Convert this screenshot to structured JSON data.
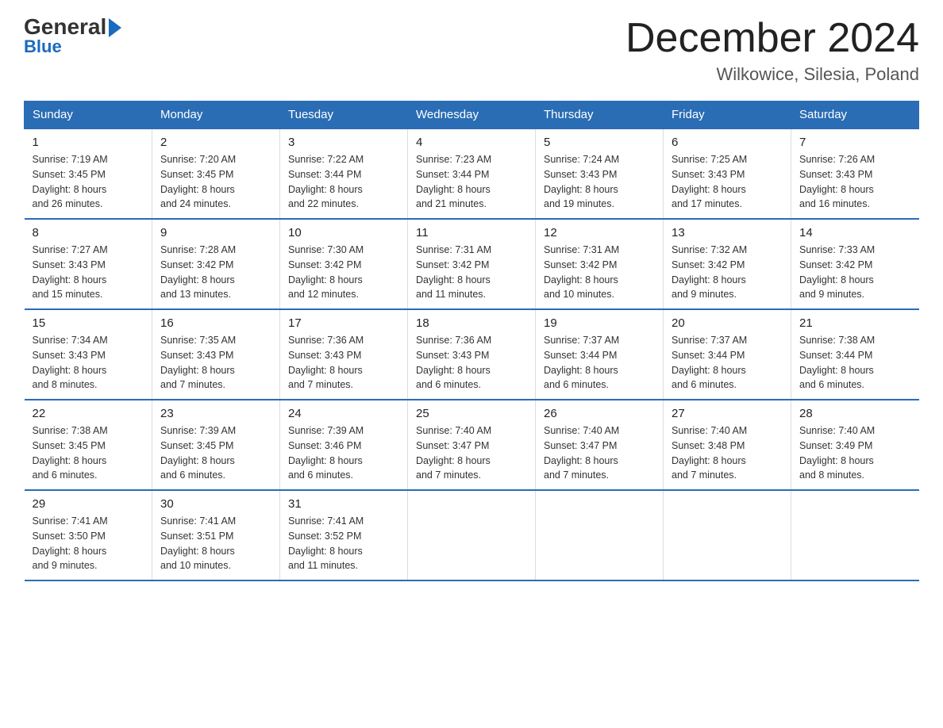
{
  "header": {
    "logo_general": "General",
    "logo_blue": "Blue",
    "month_year": "December 2024",
    "location": "Wilkowice, Silesia, Poland"
  },
  "calendar": {
    "days_of_week": [
      "Sunday",
      "Monday",
      "Tuesday",
      "Wednesday",
      "Thursday",
      "Friday",
      "Saturday"
    ],
    "weeks": [
      [
        {
          "day": "1",
          "info": "Sunrise: 7:19 AM\nSunset: 3:45 PM\nDaylight: 8 hours\nand 26 minutes."
        },
        {
          "day": "2",
          "info": "Sunrise: 7:20 AM\nSunset: 3:45 PM\nDaylight: 8 hours\nand 24 minutes."
        },
        {
          "day": "3",
          "info": "Sunrise: 7:22 AM\nSunset: 3:44 PM\nDaylight: 8 hours\nand 22 minutes."
        },
        {
          "day": "4",
          "info": "Sunrise: 7:23 AM\nSunset: 3:44 PM\nDaylight: 8 hours\nand 21 minutes."
        },
        {
          "day": "5",
          "info": "Sunrise: 7:24 AM\nSunset: 3:43 PM\nDaylight: 8 hours\nand 19 minutes."
        },
        {
          "day": "6",
          "info": "Sunrise: 7:25 AM\nSunset: 3:43 PM\nDaylight: 8 hours\nand 17 minutes."
        },
        {
          "day": "7",
          "info": "Sunrise: 7:26 AM\nSunset: 3:43 PM\nDaylight: 8 hours\nand 16 minutes."
        }
      ],
      [
        {
          "day": "8",
          "info": "Sunrise: 7:27 AM\nSunset: 3:43 PM\nDaylight: 8 hours\nand 15 minutes."
        },
        {
          "day": "9",
          "info": "Sunrise: 7:28 AM\nSunset: 3:42 PM\nDaylight: 8 hours\nand 13 minutes."
        },
        {
          "day": "10",
          "info": "Sunrise: 7:30 AM\nSunset: 3:42 PM\nDaylight: 8 hours\nand 12 minutes."
        },
        {
          "day": "11",
          "info": "Sunrise: 7:31 AM\nSunset: 3:42 PM\nDaylight: 8 hours\nand 11 minutes."
        },
        {
          "day": "12",
          "info": "Sunrise: 7:31 AM\nSunset: 3:42 PM\nDaylight: 8 hours\nand 10 minutes."
        },
        {
          "day": "13",
          "info": "Sunrise: 7:32 AM\nSunset: 3:42 PM\nDaylight: 8 hours\nand 9 minutes."
        },
        {
          "day": "14",
          "info": "Sunrise: 7:33 AM\nSunset: 3:42 PM\nDaylight: 8 hours\nand 9 minutes."
        }
      ],
      [
        {
          "day": "15",
          "info": "Sunrise: 7:34 AM\nSunset: 3:43 PM\nDaylight: 8 hours\nand 8 minutes."
        },
        {
          "day": "16",
          "info": "Sunrise: 7:35 AM\nSunset: 3:43 PM\nDaylight: 8 hours\nand 7 minutes."
        },
        {
          "day": "17",
          "info": "Sunrise: 7:36 AM\nSunset: 3:43 PM\nDaylight: 8 hours\nand 7 minutes."
        },
        {
          "day": "18",
          "info": "Sunrise: 7:36 AM\nSunset: 3:43 PM\nDaylight: 8 hours\nand 6 minutes."
        },
        {
          "day": "19",
          "info": "Sunrise: 7:37 AM\nSunset: 3:44 PM\nDaylight: 8 hours\nand 6 minutes."
        },
        {
          "day": "20",
          "info": "Sunrise: 7:37 AM\nSunset: 3:44 PM\nDaylight: 8 hours\nand 6 minutes."
        },
        {
          "day": "21",
          "info": "Sunrise: 7:38 AM\nSunset: 3:44 PM\nDaylight: 8 hours\nand 6 minutes."
        }
      ],
      [
        {
          "day": "22",
          "info": "Sunrise: 7:38 AM\nSunset: 3:45 PM\nDaylight: 8 hours\nand 6 minutes."
        },
        {
          "day": "23",
          "info": "Sunrise: 7:39 AM\nSunset: 3:45 PM\nDaylight: 8 hours\nand 6 minutes."
        },
        {
          "day": "24",
          "info": "Sunrise: 7:39 AM\nSunset: 3:46 PM\nDaylight: 8 hours\nand 6 minutes."
        },
        {
          "day": "25",
          "info": "Sunrise: 7:40 AM\nSunset: 3:47 PM\nDaylight: 8 hours\nand 7 minutes."
        },
        {
          "day": "26",
          "info": "Sunrise: 7:40 AM\nSunset: 3:47 PM\nDaylight: 8 hours\nand 7 minutes."
        },
        {
          "day": "27",
          "info": "Sunrise: 7:40 AM\nSunset: 3:48 PM\nDaylight: 8 hours\nand 7 minutes."
        },
        {
          "day": "28",
          "info": "Sunrise: 7:40 AM\nSunset: 3:49 PM\nDaylight: 8 hours\nand 8 minutes."
        }
      ],
      [
        {
          "day": "29",
          "info": "Sunrise: 7:41 AM\nSunset: 3:50 PM\nDaylight: 8 hours\nand 9 minutes."
        },
        {
          "day": "30",
          "info": "Sunrise: 7:41 AM\nSunset: 3:51 PM\nDaylight: 8 hours\nand 10 minutes."
        },
        {
          "day": "31",
          "info": "Sunrise: 7:41 AM\nSunset: 3:52 PM\nDaylight: 8 hours\nand 11 minutes."
        },
        {
          "day": "",
          "info": ""
        },
        {
          "day": "",
          "info": ""
        },
        {
          "day": "",
          "info": ""
        },
        {
          "day": "",
          "info": ""
        }
      ]
    ]
  }
}
